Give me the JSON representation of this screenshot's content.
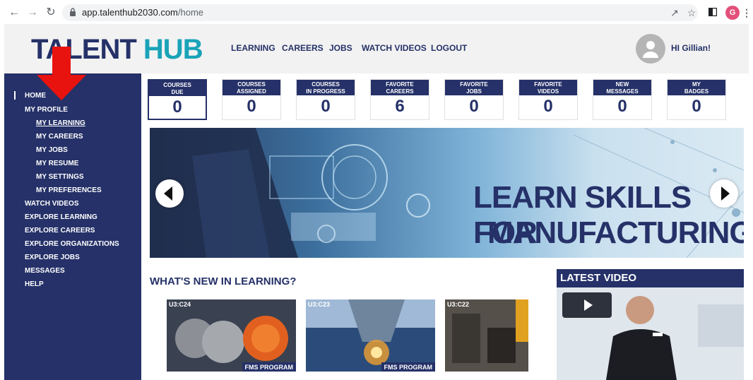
{
  "browser": {
    "url_host": "app.talenthub2030.com",
    "url_path": "/home",
    "profile_initial": "G",
    "icons": [
      "back-icon",
      "forward-icon",
      "reload-icon",
      "lock-icon",
      "share-icon",
      "star-icon",
      "sidepanel-icon",
      "menu-icon"
    ]
  },
  "header": {
    "logo_part1": "TALENT",
    "logo_part2": "HUB",
    "nav": [
      "LEARNING",
      "CAREERS",
      "JOBS",
      "WATCH VIDEOS",
      "LOGOUT"
    ],
    "greeting": "HI Gillian!"
  },
  "sidebar": {
    "items": [
      {
        "label": "HOME"
      },
      {
        "label": "MY PROFILE"
      },
      {
        "label": "MY LEARNING"
      },
      {
        "label": "MY CAREERS"
      },
      {
        "label": "MY JOBS"
      },
      {
        "label": "MY RESUME"
      },
      {
        "label": "MY SETTINGS"
      },
      {
        "label": "MY PREFERENCES"
      },
      {
        "label": "WATCH VIDEOS"
      },
      {
        "label": "EXPLORE LEARNING"
      },
      {
        "label": "EXPLORE CAREERS"
      },
      {
        "label": "EXPLORE ORGANIZATIONS"
      },
      {
        "label": "EXPLORE JOBS"
      },
      {
        "label": "MESSAGES"
      },
      {
        "label": "HELP"
      }
    ]
  },
  "stats": [
    {
      "line1": "COURSES",
      "line2": "DUE",
      "value": "0"
    },
    {
      "line1": "COURSES",
      "line2": "ASSIGNED",
      "value": "0"
    },
    {
      "line1": "COURSES",
      "line2": "IN PROGRESS",
      "value": "0"
    },
    {
      "line1": "FAVORITE",
      "line2": "CAREERS",
      "value": "6"
    },
    {
      "line1": "FAVORITE",
      "line2": "JOBS",
      "value": "0"
    },
    {
      "line1": "FAVORITE",
      "line2": "VIDEOS",
      "value": "0"
    },
    {
      "line1": "NEW",
      "line2": "MESSAGES",
      "value": "0"
    },
    {
      "line1": "MY",
      "line2": "BADGES",
      "value": "0"
    }
  ],
  "banner": {
    "line1": "LEARN SKILLS FOR",
    "line2": "MANUFACTURING"
  },
  "whats_new": {
    "title": "WHAT'S NEW IN LEARNING?",
    "courses": [
      {
        "code": "U3:C24",
        "tag": "FMS PROGRAM"
      },
      {
        "code": "U3:C23",
        "tag": "FMS PROGRAM"
      },
      {
        "code": "U3:C22",
        "tag": ""
      }
    ]
  },
  "latest_video": {
    "title": "LATEST VIDEO"
  },
  "colors": {
    "navy": "#253168",
    "teal": "#1aa3b8",
    "annotation_red": "#e8130e"
  }
}
